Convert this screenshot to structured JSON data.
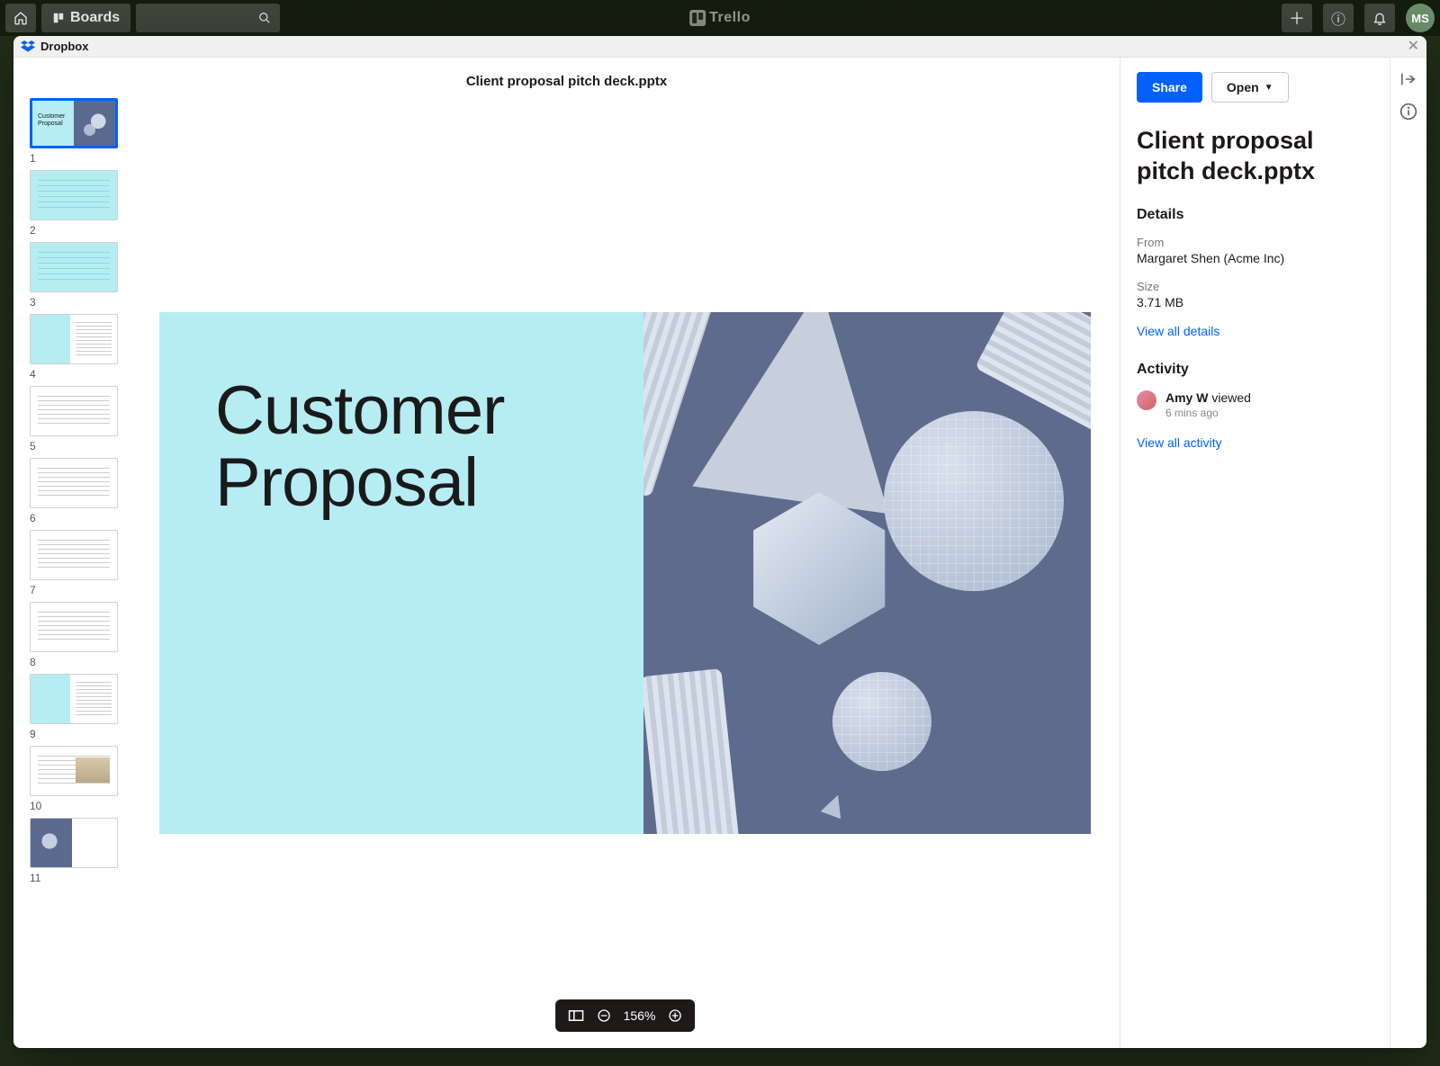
{
  "trello": {
    "boards_label": "Boards",
    "logo_text": "Trello",
    "avatar_initials": "MS"
  },
  "modal": {
    "brand": "Dropbox",
    "file_title": "Client proposal pitch deck.pptx"
  },
  "slide": {
    "title_line1": "Customer",
    "title_line2": "Proposal"
  },
  "thumbnails": [
    {
      "num": "1"
    },
    {
      "num": "2"
    },
    {
      "num": "3"
    },
    {
      "num": "4"
    },
    {
      "num": "5"
    },
    {
      "num": "6"
    },
    {
      "num": "7"
    },
    {
      "num": "8"
    },
    {
      "num": "9"
    },
    {
      "num": "10"
    },
    {
      "num": "11"
    }
  ],
  "zoom": {
    "level": "156%"
  },
  "sidebar": {
    "share_label": "Share",
    "open_label": "Open",
    "file_name": "Client proposal pitch deck.pptx",
    "details_heading": "Details",
    "from_label": "From",
    "from_value": "Margaret Shen (Acme Inc)",
    "size_label": "Size",
    "size_value": "3.71 MB",
    "view_details_link": "View all details",
    "activity_heading": "Activity",
    "activity_user": "Amy W",
    "activity_action": "viewed",
    "activity_time": "6 mins ago",
    "view_activity_link": "View all activity"
  }
}
